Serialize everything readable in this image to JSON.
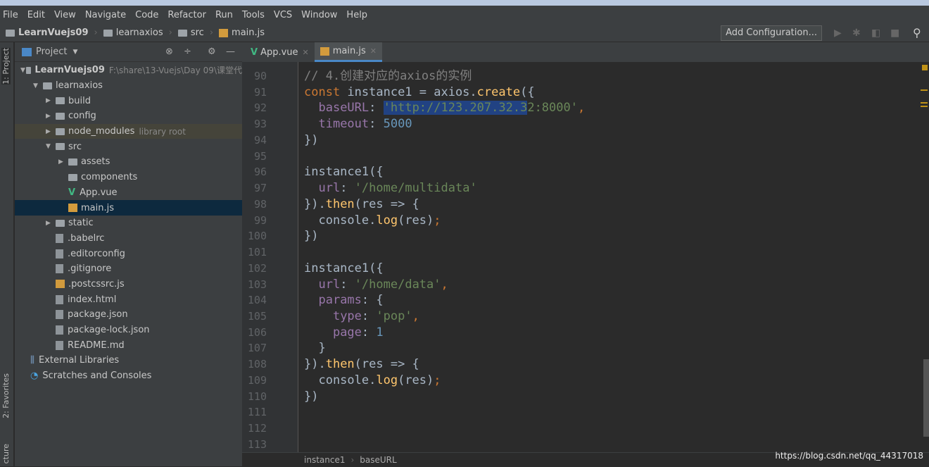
{
  "menu": [
    "File",
    "Edit",
    "View",
    "Navigate",
    "Code",
    "Refactor",
    "Run",
    "Tools",
    "VCS",
    "Window",
    "Help"
  ],
  "breadcrumb": [
    "LearnVuejs09",
    "learnaxios",
    "src",
    "main.js"
  ],
  "toolbar": {
    "add_configuration": "Add Configuration..."
  },
  "left_strip": {
    "project": "1: Project",
    "favorites": "2: Favorites",
    "structure": "cture"
  },
  "sidebar": {
    "title": "Project",
    "tree": [
      {
        "label": "LearnVuejs09",
        "hint": "F:\\share\\13-Vuejs\\Day 09\\课堂代",
        "depth": 0,
        "type": "folder",
        "arrow": "▼"
      },
      {
        "label": "learnaxios",
        "depth": 1,
        "type": "folder",
        "arrow": "▼"
      },
      {
        "label": "build",
        "depth": 2,
        "type": "folder",
        "arrow": "▶"
      },
      {
        "label": "config",
        "depth": 2,
        "type": "folder",
        "arrow": "▶"
      },
      {
        "label": "node_modules",
        "hint": "library root",
        "depth": 2,
        "type": "folder",
        "arrow": "▶",
        "lib": true
      },
      {
        "label": "src",
        "depth": 2,
        "type": "folder",
        "arrow": "▼"
      },
      {
        "label": "assets",
        "depth": 3,
        "type": "folder",
        "arrow": "▶"
      },
      {
        "label": "components",
        "depth": 3,
        "type": "folder",
        "arrow": ""
      },
      {
        "label": "App.vue",
        "depth": 3,
        "type": "vue",
        "arrow": ""
      },
      {
        "label": "main.js",
        "depth": 3,
        "type": "js",
        "arrow": "",
        "selected": true
      },
      {
        "label": "static",
        "depth": 2,
        "type": "folder",
        "arrow": "▶"
      },
      {
        "label": ".babelrc",
        "depth": 2,
        "type": "file",
        "arrow": ""
      },
      {
        "label": ".editorconfig",
        "depth": 2,
        "type": "file",
        "arrow": ""
      },
      {
        "label": ".gitignore",
        "depth": 2,
        "type": "file",
        "arrow": ""
      },
      {
        "label": ".postcssrc.js",
        "depth": 2,
        "type": "js",
        "arrow": ""
      },
      {
        "label": "index.html",
        "depth": 2,
        "type": "file",
        "arrow": ""
      },
      {
        "label": "package.json",
        "depth": 2,
        "type": "file",
        "arrow": ""
      },
      {
        "label": "package-lock.json",
        "depth": 2,
        "type": "file",
        "arrow": ""
      },
      {
        "label": "README.md",
        "depth": 2,
        "type": "file",
        "arrow": ""
      },
      {
        "label": "External Libraries",
        "depth": 0,
        "type": "lib",
        "arrow": ""
      },
      {
        "label": "Scratches and Consoles",
        "depth": 0,
        "type": "scratch",
        "arrow": ""
      }
    ]
  },
  "tabs": [
    {
      "label": "App.vue",
      "active": false
    },
    {
      "label": "main.js",
      "active": true
    }
  ],
  "code": [
    {
      "n": "90",
      "t": [
        [
          "c",
          "// 4.创建对应的axios的实例"
        ]
      ]
    },
    {
      "n": "91",
      "t": [
        [
          "k",
          "const "
        ],
        [
          "d",
          "instance1 = axios."
        ],
        [
          "f",
          "create"
        ],
        [
          "d",
          "({"
        ]
      ]
    },
    {
      "n": "92",
      "t": [
        [
          "d",
          "  "
        ],
        [
          "p",
          "baseURL"
        ],
        [
          "d",
          ": "
        ],
        [
          "s sel",
          "'http://123.207.32.3"
        ],
        [
          "s",
          "2:8000'"
        ],
        [
          "k",
          ","
        ]
      ]
    },
    {
      "n": "93",
      "t": [
        [
          "d",
          "  "
        ],
        [
          "p",
          "timeout"
        ],
        [
          "d",
          ": "
        ],
        [
          "n",
          "5000"
        ]
      ]
    },
    {
      "n": "94",
      "t": [
        [
          "d",
          "})"
        ]
      ]
    },
    {
      "n": "95",
      "t": []
    },
    {
      "n": "96",
      "t": [
        [
          "d",
          "instance1({"
        ]
      ]
    },
    {
      "n": "97",
      "t": [
        [
          "d",
          "  "
        ],
        [
          "p",
          "url"
        ],
        [
          "d",
          ": "
        ],
        [
          "s",
          "'/home/multidata'"
        ]
      ]
    },
    {
      "n": "98",
      "t": [
        [
          "d",
          "})."
        ],
        [
          "f",
          "then"
        ],
        [
          "d",
          "(res => {"
        ]
      ]
    },
    {
      "n": "99",
      "t": [
        [
          "d",
          "  console."
        ],
        [
          "f",
          "log"
        ],
        [
          "d",
          "(res)"
        ],
        [
          "k",
          ";"
        ]
      ]
    },
    {
      "n": "100",
      "t": [
        [
          "d",
          "})"
        ]
      ]
    },
    {
      "n": "101",
      "t": []
    },
    {
      "n": "102",
      "t": [
        [
          "d",
          "instance1({"
        ]
      ]
    },
    {
      "n": "103",
      "t": [
        [
          "d",
          "  "
        ],
        [
          "p",
          "url"
        ],
        [
          "d",
          ": "
        ],
        [
          "s",
          "'/home/data'"
        ],
        [
          "k",
          ","
        ]
      ]
    },
    {
      "n": "104",
      "t": [
        [
          "d",
          "  "
        ],
        [
          "p",
          "params"
        ],
        [
          "d",
          ": {"
        ]
      ]
    },
    {
      "n": "105",
      "t": [
        [
          "d",
          "    "
        ],
        [
          "p",
          "type"
        ],
        [
          "d",
          ": "
        ],
        [
          "s",
          "'pop'"
        ],
        [
          "k",
          ","
        ]
      ]
    },
    {
      "n": "106",
      "t": [
        [
          "d",
          "    "
        ],
        [
          "p",
          "page"
        ],
        [
          "d",
          ": "
        ],
        [
          "n",
          "1"
        ]
      ]
    },
    {
      "n": "107",
      "t": [
        [
          "d",
          "  }"
        ]
      ]
    },
    {
      "n": "108",
      "t": [
        [
          "d",
          "})."
        ],
        [
          "f",
          "then"
        ],
        [
          "d",
          "(res => {"
        ]
      ]
    },
    {
      "n": "109",
      "t": [
        [
          "d",
          "  console."
        ],
        [
          "f",
          "log"
        ],
        [
          "d",
          "(res)"
        ],
        [
          "k",
          ";"
        ]
      ]
    },
    {
      "n": "110",
      "t": [
        [
          "d",
          "})"
        ]
      ]
    },
    {
      "n": "111",
      "t": []
    },
    {
      "n": "112",
      "t": []
    },
    {
      "n": "113",
      "t": []
    }
  ],
  "editor_breadcrumb": [
    "instance1",
    "baseURL"
  ],
  "watermark": "https://blog.csdn.net/qq_44317018"
}
